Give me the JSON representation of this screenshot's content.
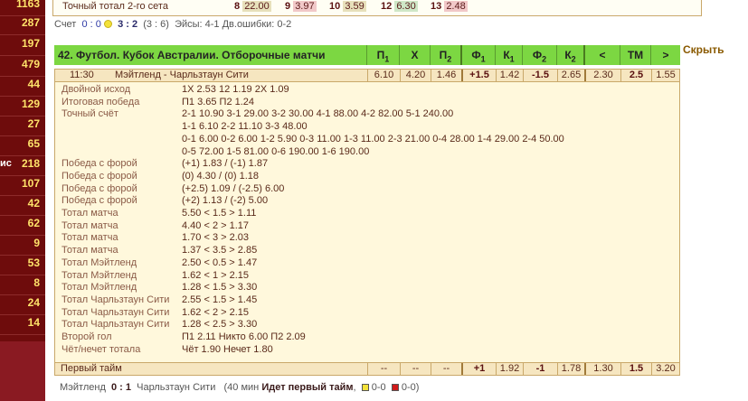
{
  "sidebar": {
    "counts": [
      "1163",
      "287",
      "197",
      "479",
      "44",
      "129",
      "27",
      "65",
      "218",
      "107",
      "42",
      "62",
      "9",
      "53",
      "8",
      "24",
      "14"
    ],
    "cut_label": "ис"
  },
  "top": {
    "label": "Точный тотал 2-го сета",
    "items": [
      {
        "k": "8",
        "v": "22.00"
      },
      {
        "k": "9",
        "v": "3.97"
      },
      {
        "k": "10",
        "v": "3.59"
      },
      {
        "k": "12",
        "v": "6.30"
      },
      {
        "k": "13",
        "v": "2.48"
      }
    ]
  },
  "score_line": {
    "prefix": "Счет",
    "score": "0 : 0",
    "sets": "3 : 2",
    "extra": "(3 : 6)",
    "aces": "Эйсы: 4-1",
    "faults": "Дв.ошибки: 0-2"
  },
  "header": {
    "title": "42. Футбол. Кубок Австралии. Отборочные матчи",
    "cols": [
      "П1",
      "Х",
      "П2",
      "Ф1",
      "К1",
      "Ф2",
      "К2",
      "<",
      "ТМ",
      ">"
    ],
    "hide": "Скрыть"
  },
  "match": {
    "time": "11:30",
    "teams": "Мэйтленд - Чарльзтаун Сити",
    "odds": [
      "6.10",
      "4.20",
      "1.46",
      "+1.5",
      "1.42",
      "-1.5",
      "2.65",
      "2.30",
      "2.5",
      "1.55"
    ]
  },
  "markets": [
    {
      "label": "Двойной исход",
      "value": "1X 2.53  12 1.19  2X 1.09"
    },
    {
      "label": "Итоговая победа",
      "value": "П1 3.65  П2 1.24"
    },
    {
      "label": "Точный счёт",
      "value": "2-1 10.90 3-1 29.00 3-2 30.00 4-1 88.00 4-2 82.00 5-1 240.00"
    },
    {
      "label": "",
      "value": "1-1 6.10 2-2 11.10 3-3 48.00"
    },
    {
      "label": "",
      "value": "0-1 6.00 0-2 6.00 1-2 5.90 0-3 11.00 1-3 11.00 2-3 21.00 0-4 28.00 1-4 29.00 2-4 50.00"
    },
    {
      "label": "",
      "value": "0-5 72.00 1-5 81.00 0-6 190.00 1-6 190.00"
    },
    {
      "label": "Победа с форой",
      "value": "(+1) 1.83 / (-1) 1.87"
    },
    {
      "label": "Победа с форой",
      "value": "(0) 4.30 / (0) 1.18"
    },
    {
      "label": "Победа с форой",
      "value": "(+2.5) 1.09 / (-2.5) 6.00"
    },
    {
      "label": "Победа с форой",
      "value": "(+2) 1.13 / (-2) 5.00"
    },
    {
      "label": "Тотал матча",
      "value": "5.50 < 1.5 > 1.11"
    },
    {
      "label": "Тотал матча",
      "value": "4.40 < 2 > 1.17"
    },
    {
      "label": "Тотал матча",
      "value": "1.70 < 3 > 2.03"
    },
    {
      "label": "Тотал матча",
      "value": "1.37 < 3.5 > 2.85"
    },
    {
      "label": "Тотал Мэйтленд",
      "value": "2.50 < 0.5 > 1.47"
    },
    {
      "label": "Тотал Мэйтленд",
      "value": "1.62 < 1 > 2.15"
    },
    {
      "label": "Тотал Мэйтленд",
      "value": "1.28 < 1.5 > 3.30"
    },
    {
      "label": "Тотал Чарльзтаун Сити",
      "value": "2.55 < 1.5 > 1.45"
    },
    {
      "label": "Тотал Чарльзтаун Сити",
      "value": "1.62 < 2 > 2.15"
    },
    {
      "label": "Тотал Чарльзтаун Сити",
      "value": "1.28 < 2.5 > 3.30"
    },
    {
      "label": "Второй гол",
      "value": "П1 2.11  Никто 6.00  П2 2.09"
    },
    {
      "label": "Чёт/нечет тотала",
      "value": "Чёт 1.90  Нечет 1.80"
    }
  ],
  "first_half": {
    "label": "Первый тайм",
    "odds": [
      "--",
      "--",
      "--",
      "+1",
      "1.92",
      "-1",
      "1.78",
      "1.30",
      "1.5",
      "3.20"
    ]
  },
  "bottom": {
    "home": "Мэйтленд",
    "score": "0 : 1",
    "away": "Чарльзтаун Сити",
    "status_pre": "(40 мин",
    "status": "Идет первый тайм",
    "yc": "0-0",
    "rc": "0-0)"
  }
}
